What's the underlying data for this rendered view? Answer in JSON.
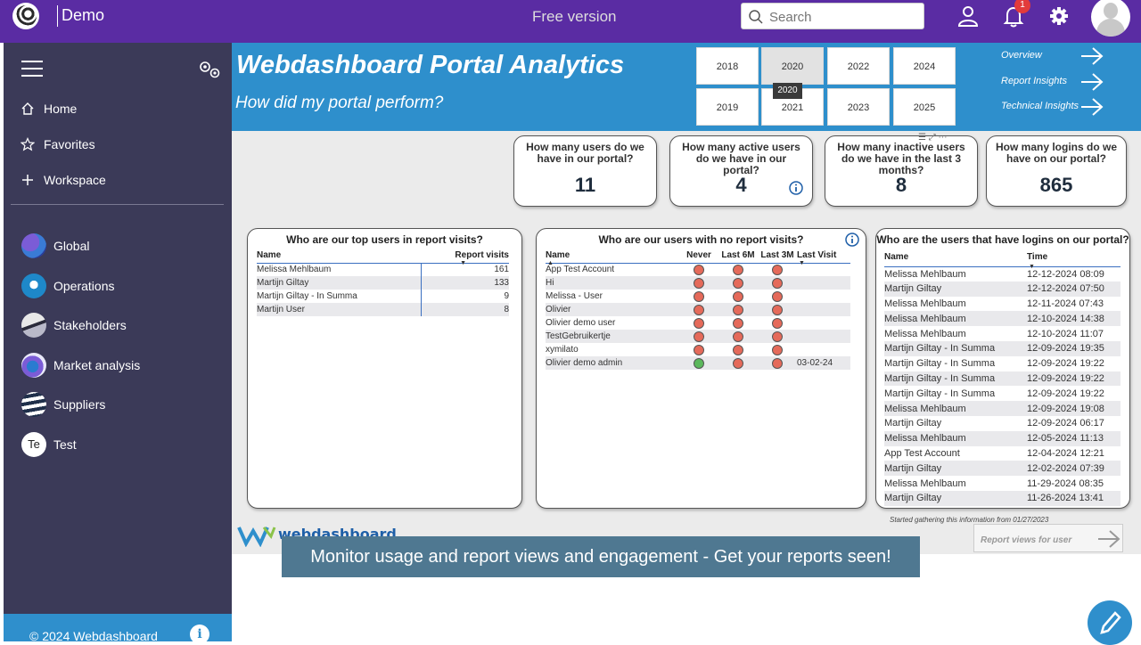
{
  "topbar": {
    "app_title": "Demo",
    "free_version": "Free version",
    "search_placeholder": "Search",
    "notification_count": "1"
  },
  "sidebar": {
    "nav": [
      {
        "label": "Home",
        "icon": "home-icon"
      },
      {
        "label": "Favorites",
        "icon": "star-icon"
      },
      {
        "label": "Workspace",
        "icon": "plus-icon"
      }
    ],
    "workspaces": [
      {
        "label": "Global",
        "icon": "globe-icon"
      },
      {
        "label": "Operations",
        "icon": "operations-icon"
      },
      {
        "label": "Stakeholders",
        "icon": "stakeholders-icon"
      },
      {
        "label": "Market analysis",
        "icon": "market-icon"
      },
      {
        "label": "Suppliers",
        "icon": "suppliers-icon"
      },
      {
        "label": "Test",
        "initials": "Te"
      }
    ],
    "footer": "© 2024 Webdashboard"
  },
  "report": {
    "title": "Webdashboard Portal Analytics",
    "subtitle": "How did my portal perform?",
    "years_row1": [
      "2018",
      "2020",
      "2022",
      "2024"
    ],
    "years_row2": [
      "2019",
      "2021",
      "2023",
      "2025"
    ],
    "selected_year": "2020",
    "tooltip": "2020",
    "nav_links": [
      "Overview",
      "Report Insights",
      "Technical Insights"
    ],
    "kpis": [
      {
        "question": "How many users do we have in our portal?",
        "value": "11"
      },
      {
        "question": "How many active users do we have in our portal?",
        "value": "4"
      },
      {
        "question": "How many inactive users do we have in the last 3 months?",
        "value": "8"
      },
      {
        "question": "How many logins do we have on our portal?",
        "value": "865"
      }
    ],
    "top_users": {
      "title": "Who are our top users in report visits?",
      "columns": [
        "Name",
        "Report visits"
      ],
      "rows": [
        [
          "Melissa Mehlbaum",
          "161"
        ],
        [
          "Martijn Giltay",
          "133"
        ],
        [
          "Martijn Giltay - In Summa",
          "9"
        ],
        [
          "Martijn User",
          "8"
        ]
      ]
    },
    "no_visits": {
      "title": "Who are our users with no report visits?",
      "columns": [
        "Name",
        "Never",
        "Last 6M",
        "Last 3M",
        "Last Visit"
      ],
      "rows": [
        {
          "name": "App Test Account",
          "never": "red",
          "m6": "red",
          "m3": "red",
          "last": ""
        },
        {
          "name": "Hi",
          "never": "red",
          "m6": "red",
          "m3": "red",
          "last": ""
        },
        {
          "name": "Melissa - User",
          "never": "red",
          "m6": "red",
          "m3": "red",
          "last": ""
        },
        {
          "name": "Olivier",
          "never": "red",
          "m6": "red",
          "m3": "red",
          "last": ""
        },
        {
          "name": "Olivier demo user",
          "never": "red",
          "m6": "red",
          "m3": "red",
          "last": ""
        },
        {
          "name": "TestGebruikertje",
          "never": "red",
          "m6": "red",
          "m3": "red",
          "last": ""
        },
        {
          "name": "xymilato",
          "never": "red",
          "m6": "red",
          "m3": "red",
          "last": ""
        },
        {
          "name": "Olivier demo admin",
          "never": "green",
          "m6": "red",
          "m3": "red",
          "last": "03-02-24"
        }
      ]
    },
    "logins": {
      "title": "Who are the users that have logins on our portal?",
      "columns": [
        "Name",
        "Time"
      ],
      "rows": [
        [
          "Melissa Mehlbaum",
          "12-12-2024 08:09"
        ],
        [
          "Martijn Giltay",
          "12-12-2024 07:50"
        ],
        [
          "Melissa Mehlbaum",
          "12-11-2024 07:43"
        ],
        [
          "Melissa Mehlbaum",
          "12-10-2024 14:38"
        ],
        [
          "Melissa Mehlbaum",
          "12-10-2024 11:07"
        ],
        [
          "Martijn Giltay - In Summa",
          "12-09-2024 19:35"
        ],
        [
          "Martijn Giltay - In Summa",
          "12-09-2024 19:22"
        ],
        [
          "Martijn Giltay - In Summa",
          "12-09-2024 19:22"
        ],
        [
          "Martijn Giltay - In Summa",
          "12-09-2024 19:22"
        ],
        [
          "Melissa Mehlbaum",
          "12-09-2024 19:08"
        ],
        [
          "Martijn Giltay",
          "12-09-2024 06:17"
        ],
        [
          "Melissa Mehlbaum",
          "12-05-2024 11:13"
        ],
        [
          "App Test Account",
          "12-04-2024 12:21"
        ],
        [
          "Martijn Giltay",
          "12-02-2024 07:39"
        ],
        [
          "Melissa Mehlbaum",
          "11-29-2024 08:35"
        ],
        [
          "Martijn Giltay",
          "11-26-2024 13:41"
        ]
      ]
    },
    "started_note": "Started gathering this information from 01/27/2023",
    "report_views_btn": "Report views for user",
    "brand_logo": "webdashboard"
  },
  "caption": "Monitor usage and report views and engagement - Get your reports seen!",
  "colors": {
    "topbar": "#5a2ca3",
    "sidebar": "#3b3a58",
    "header": "#2e8fcc",
    "status_red": "#e56a5a",
    "status_green": "#5cb85c"
  }
}
